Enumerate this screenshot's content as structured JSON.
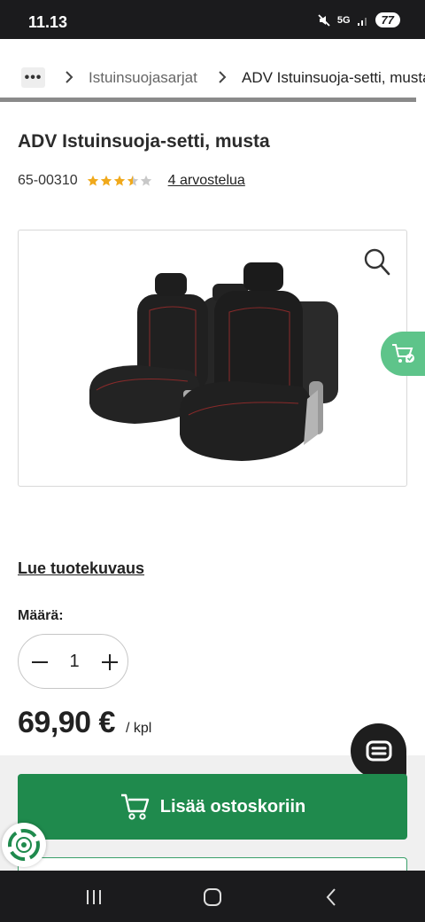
{
  "status_bar": {
    "time": "11.13",
    "network": "5G",
    "battery": "77"
  },
  "breadcrumb": {
    "more": "•••",
    "items": [
      {
        "label": "Istuinsuojasarjat"
      },
      {
        "label": "ADV Istuinsuoja-setti, musta"
      }
    ]
  },
  "product": {
    "title": "ADV Istuinsuoja-setti, musta",
    "sku": "65-00310",
    "rating": 3.5,
    "rating_max": 5,
    "reviews_label": "4 arvostelua",
    "image_icon": "seat-cover-set-image",
    "read_description": "Lue tuotekuvaus",
    "quantity_label": "Määrä:",
    "quantity": "1",
    "price": "69,90 €",
    "unit": "/ kpl"
  },
  "actions": {
    "add_to_cart": "Lisää ostoskoriin"
  },
  "colors": {
    "accent_green": "#1f8a4d",
    "fab_green": "#5ec48a",
    "star": "#f0a91c",
    "star_empty": "#c8c8c8",
    "status_bar": "#1b1b1d"
  }
}
